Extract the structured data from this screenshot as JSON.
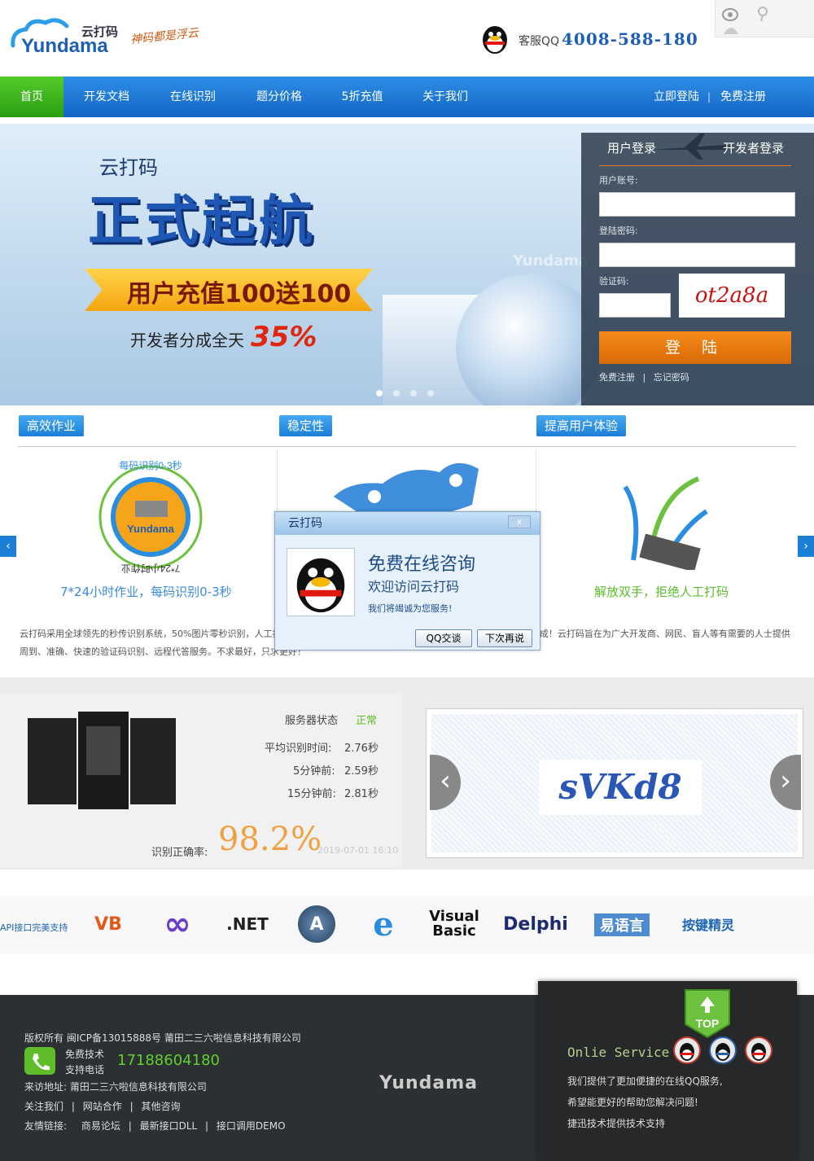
{
  "header": {
    "logo_text": "Yundama",
    "logo_cn": "云打码",
    "slogan": "神码都是浮云",
    "qq_label": "客服QQ",
    "qq_phone": "4008-588-180"
  },
  "nav": {
    "home": "首页",
    "items": [
      "开发文档",
      "在线识别",
      "题分价格",
      "5折充值",
      "关于我们"
    ],
    "login": "立即登陆",
    "sep": "|",
    "register": "免费注册"
  },
  "banner": {
    "title": "云打码",
    "big": "正式起航",
    "ribbon": "用户充值100送100",
    "dev_text": "开发者分成全天",
    "dev_pct": "35%",
    "watermark": "Yundama"
  },
  "login": {
    "tab_user": "用户登录",
    "tab_dev": "开发者登录",
    "account_label": "用户账号:",
    "password_label": "登陆密码:",
    "captcha_label": "验证码:",
    "captcha_text": "ot2a8a",
    "button": "登 陆",
    "register": "免费注册",
    "sep": "|",
    "forgot": "忘记密码"
  },
  "features": {
    "tags": [
      "高效作业",
      "稳定性",
      "提高用户体验"
    ],
    "cap1": "7*24小时作业，每码识别0-3秒",
    "cap3": "解放双手，拒绝人工打码",
    "ring_top": "每码识别0-3秒",
    "ring_bottom": "7*24小时作业",
    "hex_logo": "Yundama",
    "desc": "云打码采用全球领先的秒传识别系统，50%图片零秒识别，人工打码质量保证，支持多种验证码类型，开发者更可享受最高 35% 分成！云打码旨在为广大开发商、网民、盲人等有需要的人士提供周到、准确、快速的验证码识别、远程代答服务。不求最好，只求更好！"
  },
  "popup": {
    "title": "云打码",
    "close": "x",
    "heading": "免费在线咨询",
    "sub": "欢迎访问云打码",
    "small": "我们将竭诚为您服务!",
    "btn_qq": "QQ交谈",
    "btn_later": "下次再说"
  },
  "server": {
    "status_label": "服务器状态",
    "status_value": "正常",
    "avg_label": "平均识别时间:",
    "avg_value": "2.76秒",
    "m5_label": "5分钟前:",
    "m5_value": "2.59秒",
    "m15_label": "15分钟前:",
    "m15_value": "2.81秒",
    "rate_label": "识别正确率:",
    "rate_value": "98.2%",
    "rate_date": "2019-07-01 16:10",
    "captcha_sample": "sVKd8"
  },
  "api": {
    "label": "API接口完美支持",
    "logos": [
      "VB",
      "∞",
      ".NET",
      "A",
      "e",
      "Visual Basic",
      "Delphi",
      "易语言",
      "按键精灵"
    ]
  },
  "footer": {
    "copyright": "版权所有  闽ICP备13015888号  莆田二三六啦信息科技有限公司",
    "free_tech": "免费技术",
    "support_phone": "支持电话",
    "phone": "17188604180",
    "address": "来访地址:  莆田二三六啦信息科技有限公司",
    "follow": "关注我们",
    "coop": "网站合作",
    "other": "其他咨询",
    "sep": "|",
    "links_label": "友情链接:",
    "link1": "商易论坛",
    "link2": "最新接口DLL",
    "link3": "接口调用DEMO",
    "logo": "Yundama"
  },
  "service": {
    "title": "Onlie Service",
    "line1": "我们提供了更加便捷的在线QQ服务,",
    "line2": "希望能更好的帮助您解决问题!",
    "line3": "捷迅技术提供技术支持",
    "top": "TOP"
  }
}
